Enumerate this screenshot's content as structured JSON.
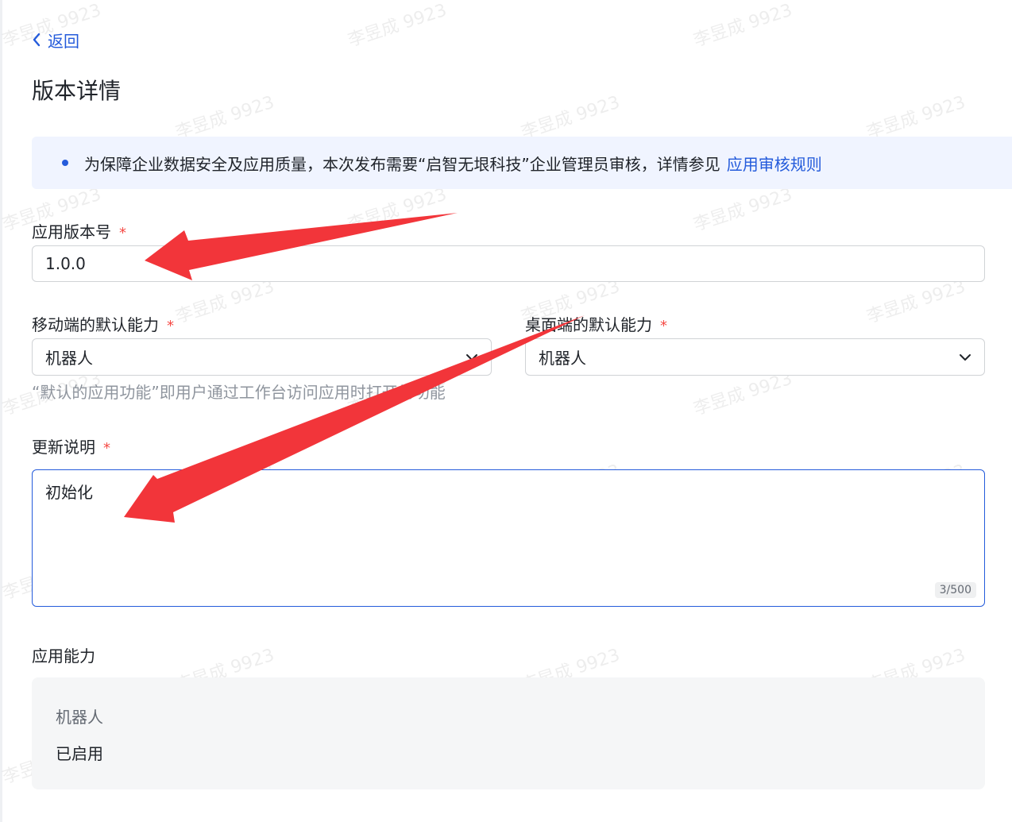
{
  "header": {
    "back_label": "返回",
    "title": "版本详情"
  },
  "notice": {
    "text": "为保障企业数据安全及应用质量，本次发布需要“启智无垠科技”企业管理员审核，详情参见",
    "link": "应用审核规则"
  },
  "form": {
    "version": {
      "label": "应用版本号",
      "required_mark": "*",
      "value": "1.0.0"
    },
    "mobile_default": {
      "label": "移动端的默认能力",
      "required_mark": "*",
      "value": "机器人"
    },
    "desktop_default": {
      "label": "桌面端的默认能力",
      "required_mark": "*",
      "value": "机器人"
    },
    "default_hint": "“默认的应用功能”即用户通过工作台访问应用时打开的功能",
    "release_notes": {
      "label": "更新说明",
      "required_mark": "*",
      "value": "初始化",
      "counter": "3/500"
    }
  },
  "capabilities": {
    "label": "应用能力",
    "name": "机器人",
    "status": "已启用"
  },
  "watermark": "李昱成 9923",
  "colors": {
    "accent": "#245bdb",
    "required": "#f54a45",
    "annotation_arrow": "#f2353a"
  },
  "icons": [
    "chevron-left-icon",
    "chevron-down-icon"
  ]
}
